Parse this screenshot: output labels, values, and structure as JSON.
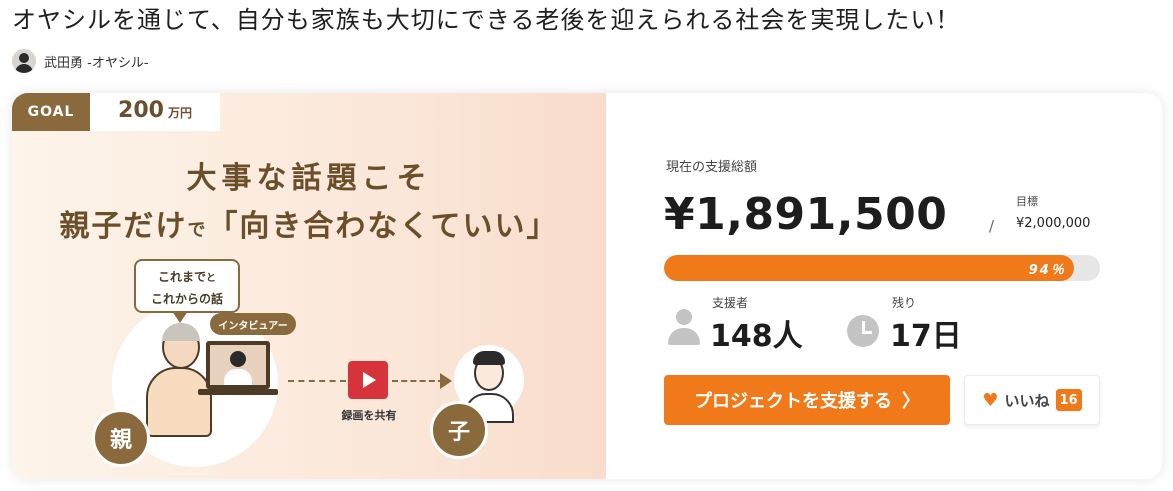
{
  "project": {
    "title": "オヤシルを通じて、自分も家族も大切にできる老後を迎えられる社会を実現したい！",
    "author": "武田勇 -オヤシル-"
  },
  "hero": {
    "goal_label": "GOAL",
    "goal_amount": "200",
    "goal_unit": "万円",
    "headline_line1": "大事な話題こそ",
    "headline_line2_a": "親子だけ",
    "headline_line2_small": "で",
    "headline_line2_b": "「向き合わなくていい」",
    "bubble_line1": "これまで",
    "bubble_line1_small": "と",
    "bubble_line2": "これからの話",
    "interviewer_tag": "インタビュアー",
    "share_label": "録画を共有",
    "role_parent": "親",
    "role_child": "子"
  },
  "stats": {
    "total_label": "現在の支援総額",
    "total_amount": "¥1,891,500",
    "slash": "/",
    "target_label": "目標",
    "target_amount": "¥2,000,000",
    "progress_percent": 94,
    "progress_text": "94％",
    "supporters_label": "支援者",
    "supporters_value": "148人",
    "remaining_label": "残り",
    "remaining_value": "17日"
  },
  "actions": {
    "support_label": "プロジェクトを支援する",
    "support_chevron": "〉",
    "like_label": "いいね",
    "like_count": "16"
  },
  "icons": {
    "avatar": "author-avatar",
    "person": "person-icon",
    "clock": "clock-icon",
    "heart": "heart-icon",
    "play": "play-icon"
  },
  "colors": {
    "accent": "#f07a1a",
    "brown": "#8a6a3c",
    "play_red": "#d6343a",
    "progress_track": "#e6e6e6"
  }
}
